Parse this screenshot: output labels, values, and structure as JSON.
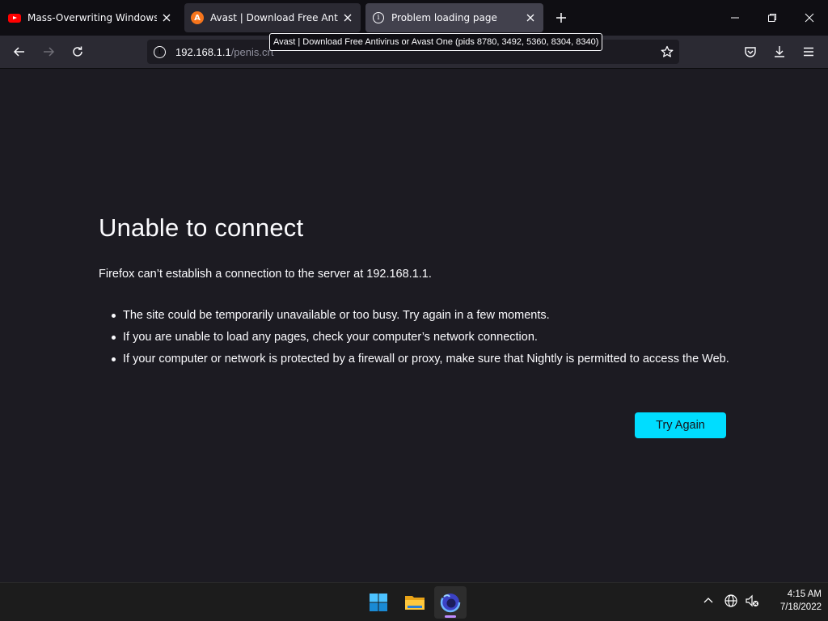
{
  "tabs": [
    {
      "title": "Mass-Overwriting Windows Reg",
      "icon": "youtube-icon"
    },
    {
      "title": "Avast | Download Free Antivirus",
      "icon": "avast-icon"
    },
    {
      "title": "Problem loading page",
      "icon": "info-icon",
      "active": true
    }
  ],
  "tooltip": "Avast | Download Free Antivirus or Avast One (pids 8780, 3492, 5360, 8304, 8340)",
  "urlbar": {
    "host": "192.168.1.1",
    "path": "/penis.crt"
  },
  "page": {
    "title": "Unable to connect",
    "description": "Firefox can’t establish a connection to the server at 192.168.1.1.",
    "bullets": [
      "The site could be temporarily unavailable or too busy. Try again in a few moments.",
      "If you are unable to load any pages, check your computer’s network connection.",
      "If your computer or network is protected by a firewall or proxy, make sure that Nightly is permitted to access the Web."
    ],
    "button": "Try Again"
  },
  "taskbar": {
    "apps": [
      "start-icon",
      "file-explorer-icon",
      "firefox-nightly-icon"
    ],
    "time": "4:15 AM",
    "date": "7/18/2022"
  },
  "colors": {
    "accent": "#00ddff",
    "page_bg": "#1c1b22",
    "toolbar_bg": "#2b2a33",
    "tabstrip_bg": "#0f0e13"
  }
}
